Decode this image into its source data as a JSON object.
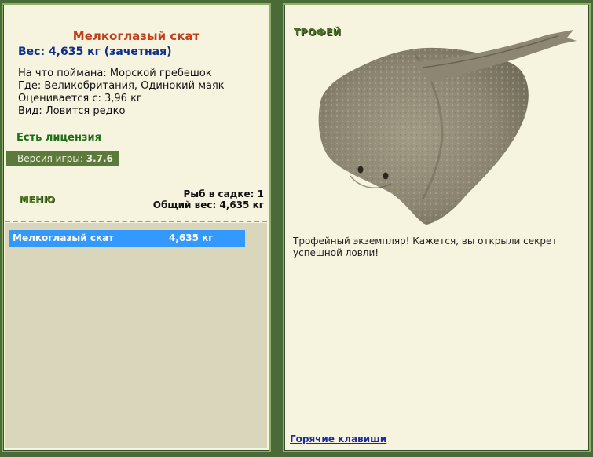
{
  "fish": {
    "name": "Мелкоглазый скат",
    "weight": "Вес: 4,635 кг (зачетная)",
    "bait": "На что поймана: Морской гребешок",
    "location": "Где: Великобритания, Одинокий маяк",
    "valued_from": "Оценивается с: 3,96 кг",
    "species": "Вид: Ловится редко"
  },
  "license": "Есть лицензия",
  "version": {
    "label": "Версия игры:",
    "value": "3.7.6"
  },
  "menu_label": "МЕНЮ",
  "stats": {
    "fish_in_keepnet": "Рыб в садке: 1",
    "total_weight": "Общий вес: 4,635 кг"
  },
  "catch_list": [
    {
      "name": "Мелкоглазый скат",
      "weight": "4,635 кг"
    }
  ],
  "trophy_label": "ТРОФЕЙ",
  "trophy_text": "Трофейный экземпляр! Кажется, вы открыли секрет успешной ловли!",
  "hotkeys_link": "Горячие клавиши",
  "colors": {
    "background": "#4a6a37",
    "panel": "#f6f3df",
    "fish_name": "#c0401b",
    "weight": "#0e2f8a",
    "license": "#1d6c16",
    "selection": "#3399ff"
  },
  "icons": {
    "fish_image": "skate-fish-image"
  }
}
